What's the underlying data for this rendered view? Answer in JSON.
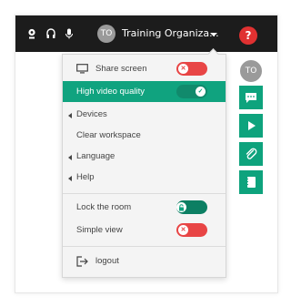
{
  "topbar": {
    "org_initials": "TO",
    "org_name": "Training Organiza...",
    "help_label": "?"
  },
  "sidebar": {
    "avatar_initials": "TO"
  },
  "menu": {
    "share_screen": "Share screen",
    "high_video_quality": "High video quality",
    "devices": "Devices",
    "clear_workspace": "Clear workspace",
    "language": "Language",
    "help": "Help",
    "lock_the_room": "Lock the room",
    "simple_view": "Simple view",
    "logout": "logout"
  },
  "toggles": {
    "share_screen": "off",
    "high_video_quality": "on",
    "lock_the_room": "on",
    "simple_view": "off"
  },
  "colors": {
    "accent": "#10a37f",
    "toggle_off": "#e84545",
    "help": "#e03131",
    "topbar": "#1c1c1c"
  }
}
